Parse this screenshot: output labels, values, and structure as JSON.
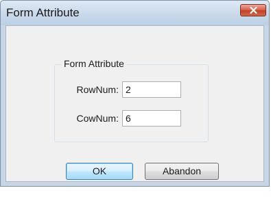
{
  "window": {
    "title": "Form Attribute",
    "close_icon": "close-icon"
  },
  "group": {
    "legend": "Form Attribute"
  },
  "fields": {
    "row_label": "RowNum:",
    "row_value": "2",
    "col_label": "CowNum:",
    "col_value": "6"
  },
  "buttons": {
    "ok_label": "OK",
    "abandon_label": "Abandon"
  },
  "colors": {
    "titlebar": "#c9d9ea",
    "close_button": "#c2402a",
    "client_background": "#f0f0f0",
    "default_button_border": "#3c7fb1"
  }
}
